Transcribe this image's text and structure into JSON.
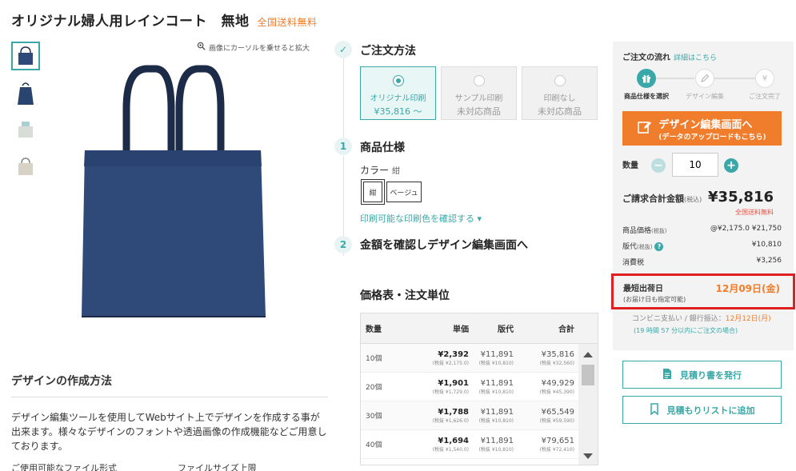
{
  "product": {
    "title": "オリジナル婦人用レインコート　無地",
    "free_shipping": "全国送料無料",
    "zoom_hint": "画像にカーソルを乗せると拡大"
  },
  "thumbnails": [
    "thumb-1",
    "thumb-2",
    "thumb-3",
    "thumb-4"
  ],
  "design_method": {
    "heading": "デザインの作成方法",
    "body": "デザイン編集ツールを使用してWebサイト上でデザインを作成する事が出来ます。様々なデザインのフォントや透過画像の作成機能などご用意しております。",
    "file_formats_label": "ご使用可能なファイル形式",
    "file_size_label": "ファイルサイズ上限"
  },
  "order": {
    "method_title": "ご注文方法",
    "options": [
      {
        "label": "オリジナル印刷",
        "sub": "¥35,816 ～"
      },
      {
        "label": "サンプル印刷",
        "sub": "未対応商品"
      },
      {
        "label": "印刷なし",
        "sub": "未対応商品"
      }
    ],
    "step1_num": "1",
    "step1_title": "商品仕様",
    "color_label": "カラー",
    "color_value": "紺",
    "colors": [
      "紺",
      "ベージュ"
    ],
    "color_link": "印刷可能な印刷色を確認する ▾",
    "step2_num": "2",
    "step2_title": "金額を確認しデザイン編集画面へ"
  },
  "price_table": {
    "title": "価格表・注文単位",
    "headers": {
      "qty": "数量",
      "unit": "単価",
      "plate": "版代",
      "total": "合計"
    },
    "rows": [
      {
        "qty": "10個",
        "unit": "¥2,392",
        "unit_ex": "(税抜 ¥2,175.0)",
        "plate": "¥11,891",
        "plate_ex": "(税抜 ¥10,810)",
        "total": "¥35,816",
        "total_ex": "(税抜 ¥32,560)"
      },
      {
        "qty": "20個",
        "unit": "¥1,901",
        "unit_ex": "(税抜 ¥1,729.0)",
        "plate": "¥11,891",
        "plate_ex": "(税抜 ¥10,810)",
        "total": "¥49,929",
        "total_ex": "(税抜 ¥45,390)"
      },
      {
        "qty": "30個",
        "unit": "¥1,788",
        "unit_ex": "(税抜 ¥1,626.0)",
        "plate": "¥11,891",
        "plate_ex": "(税抜 ¥10,810)",
        "total": "¥65,549",
        "total_ex": "(税抜 ¥59,590)"
      },
      {
        "qty": "40個",
        "unit": "¥1,694",
        "unit_ex": "(税抜 ¥1,540.0)",
        "plate": "¥11,891",
        "plate_ex": "(税抜 ¥10,810)",
        "total": "¥79,651",
        "total_ex": "(税抜 ¥72,410)"
      }
    ]
  },
  "flow": {
    "title": "ご注文の流れ",
    "link": "詳細はこちら",
    "steps": [
      "商品仕様を選択",
      "デザイン編集",
      "ご注文完了"
    ]
  },
  "design_button": {
    "line1": "デザイン編集画面へ",
    "line2": "(データのアップロードもこちら)"
  },
  "quantity": {
    "label": "数量",
    "value": "10"
  },
  "billing": {
    "label": "ご請求合計金額",
    "tax_note": "(税込)",
    "amount": "¥35,816",
    "free": "全国送料無料",
    "product_price_label": "商品価格",
    "product_price_note": "(税抜)",
    "product_price_calc": "@¥2,175.0 ¥21,750",
    "plate_label": "版代",
    "plate_note": "(税抜)",
    "plate_value": "¥10,810",
    "tax_label": "消費税",
    "tax_value": "¥3,256"
  },
  "shipping": {
    "label": "最短出荷日",
    "sub": "(お届け日も指定可能)",
    "date": "12月09日(金)",
    "conv_label": "コンビニ支払い / 銀行振込：",
    "conv_date": "12月12日(月)",
    "deadline": "(19 時間 57 分以内にご注文の場合)"
  },
  "actions": {
    "estimate": "見積り書を発行",
    "add_list": "見積もりリストに追加"
  },
  "colors": {
    "accent": "#3aa8a8",
    "orange": "#f07d2c",
    "red": "#e02020",
    "bag": "#2f4a78"
  }
}
